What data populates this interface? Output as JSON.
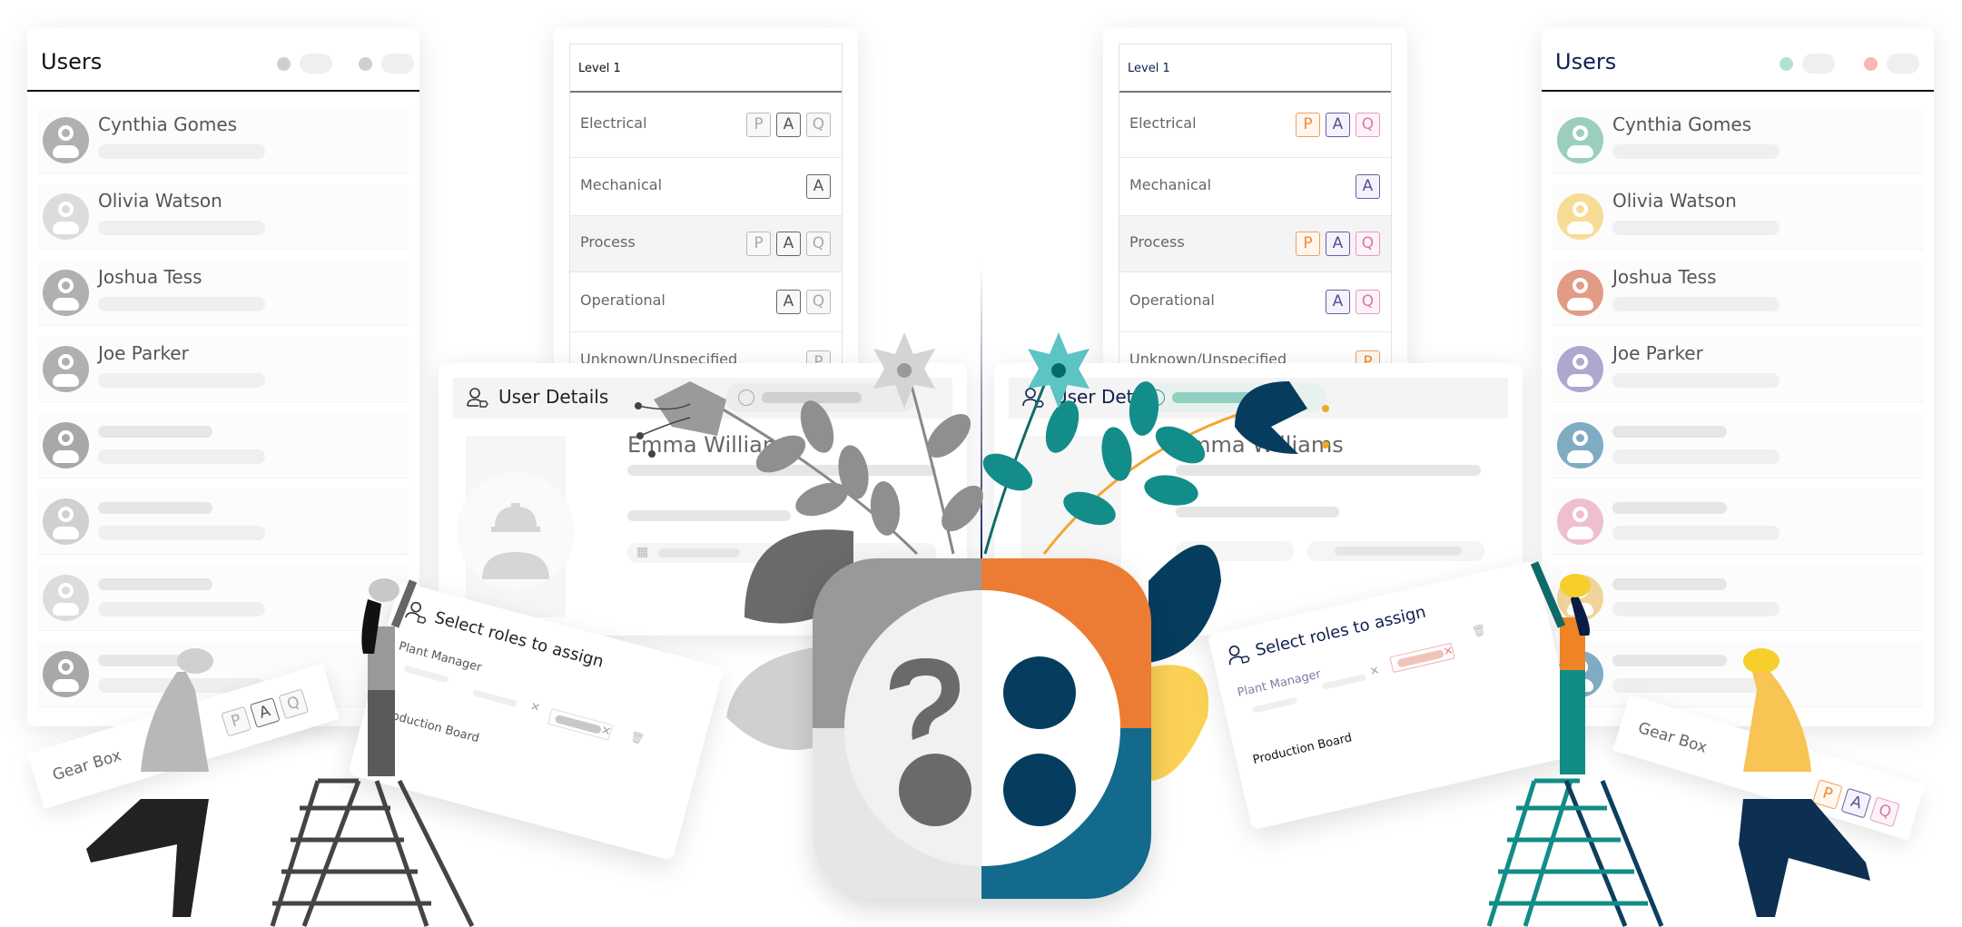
{
  "users_left": {
    "title": "Users",
    "users": [
      {
        "name": "Cynthia Gomes"
      },
      {
        "name": "Olivia Watson"
      },
      {
        "name": "Joshua Tess"
      },
      {
        "name": "Joe Parker"
      },
      {
        "name": ""
      },
      {
        "name": ""
      },
      {
        "name": ""
      },
      {
        "name": ""
      }
    ],
    "avatar_colors": [
      "#b0b0b0",
      "#dcdcdc",
      "#b0b0b0",
      "#b0b0b0",
      "#a8a8a8",
      "#d0d0d0",
      "#dcdcdc",
      "#a8a8a8"
    ],
    "header_dot_colors": [
      "#cfcfcf",
      "#cfcfcf"
    ]
  },
  "users_right": {
    "title": "Users",
    "users": [
      {
        "name": "Cynthia Gomes"
      },
      {
        "name": "Olivia Watson"
      },
      {
        "name": "Joshua Tess"
      },
      {
        "name": "Joe Parker"
      },
      {
        "name": ""
      },
      {
        "name": ""
      },
      {
        "name": ""
      },
      {
        "name": ""
      }
    ],
    "avatar_colors": [
      "#9ccfbb",
      "#f7dc95",
      "#e29b84",
      "#aea7cf",
      "#7fabc3",
      "#f0bfcf",
      "#f0d49a",
      "#7fabc3"
    ],
    "header_dot_colors": [
      "#b5e0d8",
      "#f6b8b4"
    ]
  },
  "level_left": {
    "header": "Level 1",
    "rows": [
      {
        "label": "Electrical",
        "badges": [
          "P",
          "A",
          "Q"
        ]
      },
      {
        "label": "Mechanical",
        "badges": [
          "A"
        ]
      },
      {
        "label": "Process",
        "badges": [
          "P",
          "A",
          "Q"
        ]
      },
      {
        "label": "Operational",
        "badges": [
          "A",
          "Q"
        ]
      },
      {
        "label": "Unknown/Unspecified",
        "badges": [
          "P"
        ]
      }
    ]
  },
  "level_right": {
    "header": "Level 1",
    "rows": [
      {
        "label": "Electrical",
        "badges": [
          "P",
          "A",
          "Q"
        ]
      },
      {
        "label": "Mechanical",
        "badges": [
          "A"
        ]
      },
      {
        "label": "Process",
        "badges": [
          "P",
          "A",
          "Q"
        ]
      },
      {
        "label": "Operational",
        "badges": [
          "A",
          "Q"
        ]
      },
      {
        "label": "Unknown/Unspecified",
        "badges": [
          "P"
        ]
      }
    ]
  },
  "details_left": {
    "title": "User Details",
    "name": "Emma Williams"
  },
  "details_right": {
    "title": "User Details",
    "name": "Emma Williams"
  },
  "roles_left": {
    "title": "Select roles to assign",
    "role1": "Plant Manager",
    "role2": "Production Board",
    "remove": "×"
  },
  "roles_right": {
    "title": "Select roles to assign",
    "role1": "Plant Manager",
    "role2": "Production Board",
    "remove": "×"
  },
  "gear_left": {
    "label": "Gear Box",
    "badges": [
      "P",
      "A",
      "Q"
    ]
  },
  "gear_right": {
    "label": "Gear Box",
    "badges": [
      "P",
      "A",
      "Q"
    ]
  },
  "logo": {
    "left_symbol": "?",
    "colors": {
      "grey": "#999999",
      "orange": "#ec7c34",
      "blue": "#136a8c",
      "navy": "#063d5e"
    }
  },
  "icons": {
    "user_tag": "user-tag-icon",
    "check": "check-circle-icon",
    "building": "building-icon",
    "trash": "trash-icon"
  }
}
